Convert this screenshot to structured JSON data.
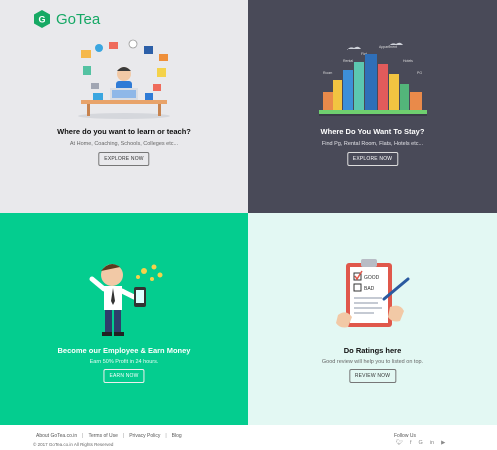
{
  "brand": {
    "logo_letter": "G",
    "name": "GoTea"
  },
  "panels": [
    {
      "title": "Where do you want to learn or teach?",
      "subtitle": "At Home, Coaching, Schools, Colleges etc...",
      "button": "EXPLORE NOW"
    },
    {
      "title": "Where Do You Want To Stay?",
      "subtitle": "Find Pg, Rental Room, Flats, Hotels etc...",
      "button": "EXPLORE NOW",
      "city_labels": [
        "Appartment",
        "Flat",
        "Rental",
        "Room",
        "Hotels",
        "PG"
      ]
    },
    {
      "title": "Become our Employee & Earn Money",
      "subtitle": "Earn 50% Profit in 24 hours.",
      "button": "EARN NOW"
    },
    {
      "title": "Do Ratings here",
      "subtitle": "Good review will help you to listed on top.",
      "button": "REVIEW NOW",
      "checklist": [
        "GOOD",
        "BAD"
      ]
    }
  ],
  "footer": {
    "links": [
      "About GoTea.co.in",
      "Privacy Policy",
      "Blog"
    ],
    "terms": "Terms of Use",
    "separator": "|",
    "copyright": "© 2017 GoTea.co.in All Rights Reserved",
    "follow": "Follow Us",
    "social_icons": [
      "twitter-icon",
      "facebook-icon",
      "google-plus-icon",
      "linkedin-icon",
      "youtube-icon"
    ]
  },
  "colors": {
    "panel1": "#e9e9ec",
    "panel2": "#494a58",
    "panel3": "#04cd8f",
    "panel4": "#e3f8f3",
    "brand": "#16a865"
  }
}
